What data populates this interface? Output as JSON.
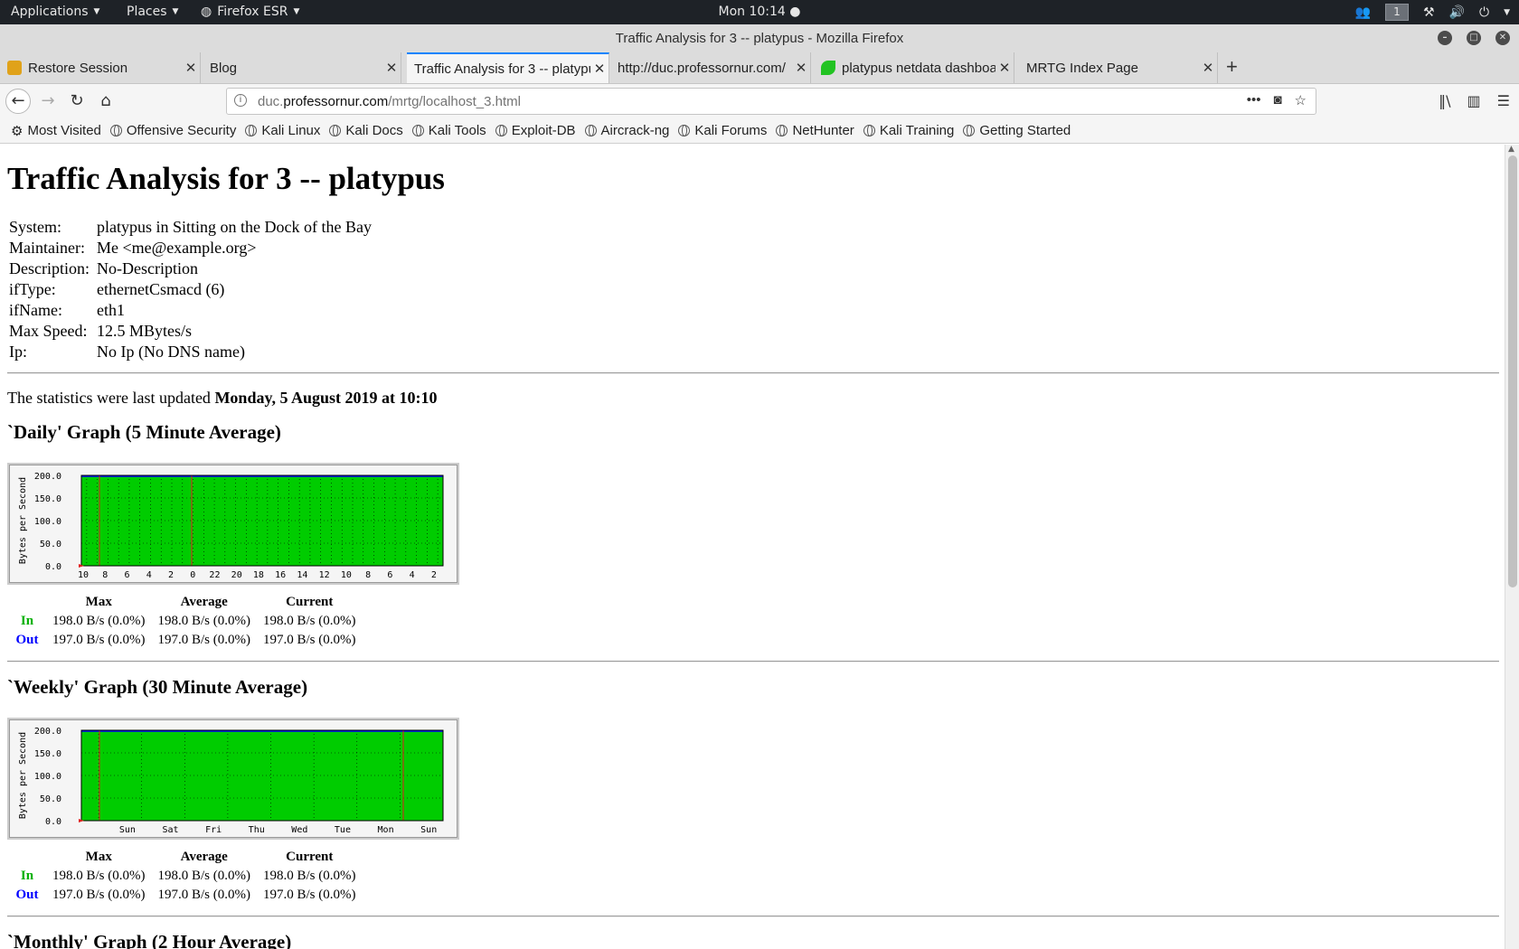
{
  "topbar": {
    "applications": "Applications",
    "places": "Places",
    "browser": "Firefox ESR",
    "clock": "Mon 10:14 ●",
    "workspace": "1"
  },
  "window": {
    "title": "Traffic Analysis for 3 -- platypus - Mozilla Firefox"
  },
  "tabs": [
    {
      "label": "Restore Session",
      "icon": "restore-session-icon",
      "color": "#e0a21a"
    },
    {
      "label": "Blog",
      "icon": "",
      "color": ""
    },
    {
      "label": "Traffic Analysis for 3 -- platypus",
      "icon": "",
      "color": ""
    },
    {
      "label": "http://duc.professornur.com/",
      "icon": "",
      "color": ""
    },
    {
      "label": "platypus netdata dashboard",
      "icon": "netdata-leaf-icon",
      "color": "#22c322"
    },
    {
      "label": "MRTG Index Page",
      "icon": "",
      "color": ""
    }
  ],
  "url": {
    "domain": "duc.professornur.com",
    "path": "/mrtg/localhost_3.html",
    "prefix": "duc."
  },
  "bookmarks": [
    "Most Visited",
    "Offensive Security",
    "Kali Linux",
    "Kali Docs",
    "Kali Tools",
    "Exploit-DB",
    "Aircrack-ng",
    "Kali Forums",
    "NetHunter",
    "Kali Training",
    "Getting Started"
  ],
  "page": {
    "heading": "Traffic Analysis for 3 -- platypus",
    "info": [
      {
        "label": "System:",
        "value": "platypus in Sitting on the Dock of the Bay"
      },
      {
        "label": "Maintainer:",
        "value": "Me <me@example.org>"
      },
      {
        "label": "Description:",
        "value": "No-Description"
      },
      {
        "label": "ifType:",
        "value": "ethernetCsmacd (6)"
      },
      {
        "label": "ifName:",
        "value": "eth1"
      },
      {
        "label": "Max Speed:",
        "value": "12.5 MBytes/s"
      },
      {
        "label": "Ip:",
        "value": "No Ip (No DNS name)"
      }
    ],
    "updated_prefix": "The statistics were last updated",
    "updated_value": "Monday, 5 August 2019 at 10:10"
  },
  "graphs": [
    {
      "title": "`Daily' Graph (5 Minute Average)",
      "ylabel": "Bytes per Second",
      "yticks": [
        "200.0",
        "150.0",
        "100.0",
        "50.0",
        "0.0"
      ],
      "xticks": [
        "10",
        "8",
        "6",
        "4",
        "2",
        "0",
        "22",
        "20",
        "18",
        "16",
        "14",
        "12",
        "10",
        "8",
        "6",
        "4",
        "2"
      ],
      "headers": [
        "Max",
        "Average",
        "Current"
      ],
      "in_label": "In",
      "out_label": "Out",
      "in": [
        "198.0 B/s (0.0%)",
        "198.0 B/s (0.0%)",
        "198.0 B/s (0.0%)"
      ],
      "out": [
        "197.0 B/s (0.0%)",
        "197.0 B/s (0.0%)",
        "197.0 B/s (0.0%)"
      ]
    },
    {
      "title": "`Weekly' Graph (30 Minute Average)",
      "ylabel": "Bytes per Second",
      "yticks": [
        "200.0",
        "150.0",
        "100.0",
        "50.0",
        "0.0"
      ],
      "xticks": [
        "Sun",
        "Sat",
        "Fri",
        "Thu",
        "Wed",
        "Tue",
        "Mon",
        "Sun"
      ],
      "headers": [
        "Max",
        "Average",
        "Current"
      ],
      "in_label": "In",
      "out_label": "Out",
      "in": [
        "198.0 B/s (0.0%)",
        "198.0 B/s (0.0%)",
        "198.0 B/s (0.0%)"
      ],
      "out": [
        "197.0 B/s (0.0%)",
        "197.0 B/s (0.0%)",
        "197.0 B/s (0.0%)"
      ]
    },
    {
      "title": "`Monthly' Graph (2 Hour Average)"
    }
  ],
  "colors": {
    "in_area": "#00cc00",
    "out_line": "#0000ff",
    "tab_accent": "#0a84ff"
  }
}
